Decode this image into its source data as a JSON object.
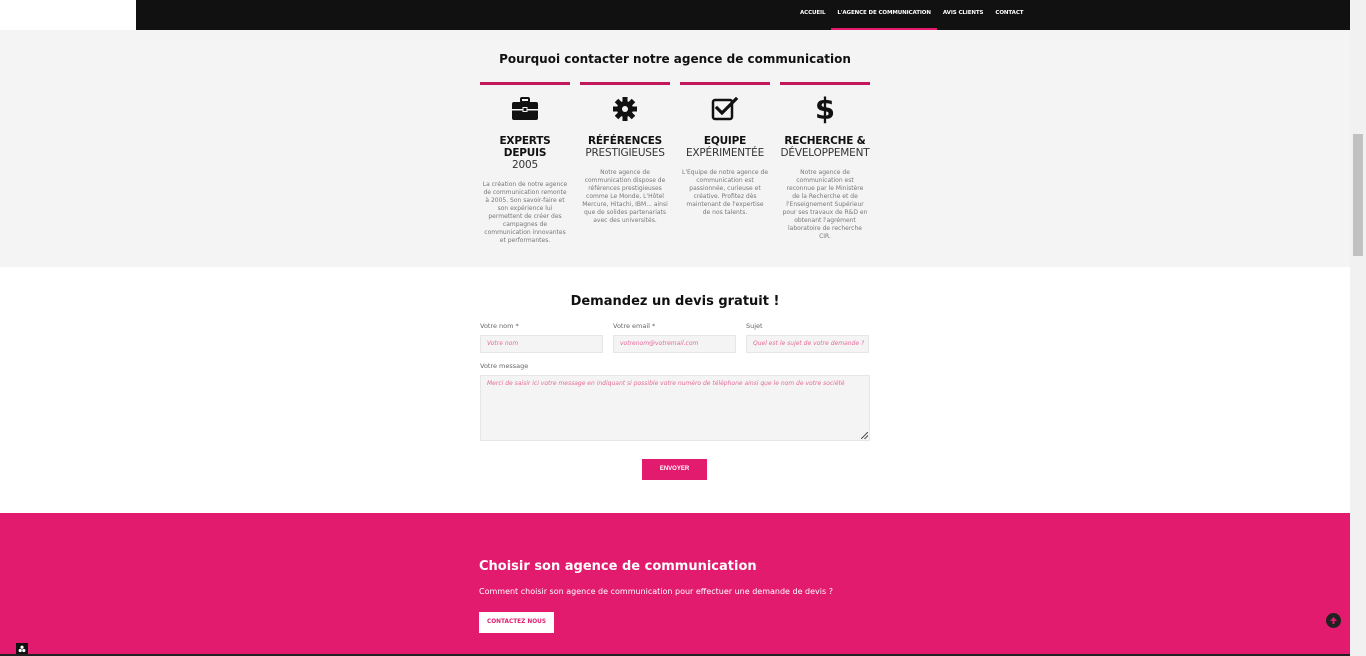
{
  "nav": {
    "items": [
      "ACCUEIL",
      "L'AGENCE DE COMMUNICATION",
      "AVIS CLIENTS",
      "CONTACT"
    ],
    "active_index": 1
  },
  "why": {
    "title": "Pourquoi contacter notre agence de communication",
    "features": [
      {
        "icon": "briefcase-icon",
        "title_line1": "EXPERTS DEPUIS",
        "title_line2": "2005",
        "desc": "La création de notre agence de communication remonte à 2005. Son savoir-faire et son expérience lui permettent de créer des campagnes de communication innovantes et performantes."
      },
      {
        "icon": "gear-icon",
        "title_line1": "RÉFÉRENCES",
        "title_line2": "PRESTIGIEUSES",
        "desc": "Notre agence de communication dispose de références prestigieuses comme Le Monde, L'Hôtel Mercure, Hitachi, IBM... ainsi que de solides partenariats avec des universités."
      },
      {
        "icon": "checkbox-icon",
        "title_line1": "EQUIPE",
        "title_line2": "EXPÉRIMENTÉE",
        "desc": "L'Equipe de notre agence de communication est passionnée, curieuse et créative. Profitez dès maintenant de l'expertise de nos talents."
      },
      {
        "icon": "dollar-icon",
        "title_line1": "RECHERCHE &",
        "title_line2": "DÉVELOPPEMENT",
        "desc": "Notre agence de communication est reconnue par le Ministère de la Recherche et de l'Enseignement Supérieur pour ses travaux de R&D en obtenant l'agrément laboratoire de recherche CIR."
      }
    ]
  },
  "devis": {
    "title": "Demandez un devis gratuit !",
    "name_label": "Votre nom *",
    "name_placeholder": "Votre nom",
    "email_label": "Votre email *",
    "email_placeholder": "votrenom@votremail.com",
    "subject_label": "Sujet",
    "subject_placeholder": "Quel est le sujet de votre demande ?",
    "message_label": "Votre message",
    "message_placeholder": "Merci de saisir ici votre message en indiquant si possible votre numéro de téléphone ainsi que le nom de votre société",
    "submit_label": "ENVOYER"
  },
  "choose": {
    "title": "Choisir son agence de communication",
    "subtitle": "Comment choisir son agence de communication pour effectuer une demande de devis ?",
    "cta_label": "CONTACTEZ NOUS"
  },
  "colors": {
    "accent": "#e21b6e",
    "nav_bg": "#111111",
    "section_bg": "#f4f4f4"
  }
}
